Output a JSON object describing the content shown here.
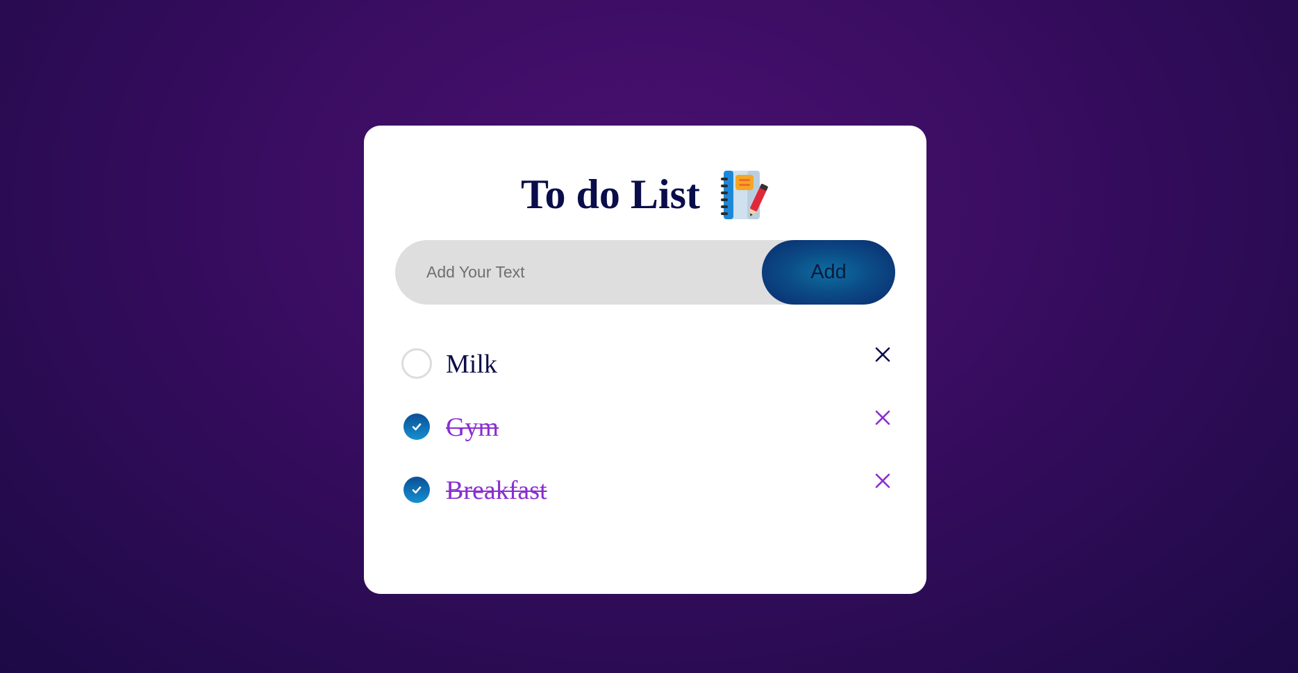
{
  "app": {
    "title": "To do List",
    "title_icon": "notebook-pencil-icon"
  },
  "input": {
    "value": "",
    "placeholder": "Add Your Text",
    "add_label": "Add"
  },
  "colors": {
    "title": "#0a0d4a",
    "done_text": "#8a2ed0",
    "check_fill": "#1590d0",
    "delete_done": "#8a2ed0",
    "delete_default": "#0a0d4a"
  },
  "tasks": [
    {
      "text": "Milk",
      "done": false,
      "delete_icon": "close-icon"
    },
    {
      "text": "Gym",
      "done": true,
      "delete_icon": "close-icon"
    },
    {
      "text": "Breakfast",
      "done": true,
      "delete_icon": "close-icon"
    }
  ]
}
